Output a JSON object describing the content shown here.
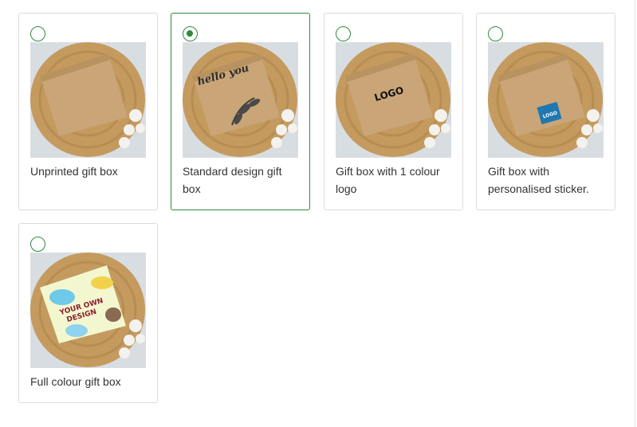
{
  "options": [
    {
      "label": "Unprinted gift box",
      "selected": false,
      "box_print": "",
      "image": "plain-kraft-box"
    },
    {
      "label": "Standard design gift box",
      "selected": true,
      "box_print": "hello you",
      "image": "hello-you-design-box"
    },
    {
      "label": "Gift box with 1 colour logo",
      "selected": false,
      "box_print": "LOGO",
      "image": "logo-print-box"
    },
    {
      "label": "Gift box with personalised sticker.",
      "selected": false,
      "box_print": "LOGO",
      "image": "logo-sticker-box"
    },
    {
      "label": "Full colour gift box",
      "selected": false,
      "box_print": "YOUR OWN DESIGN",
      "image": "full-colour-box"
    }
  ],
  "colors": {
    "accent": "#2e8b3d",
    "card_border": "#dcdcdc",
    "text": "#333333",
    "kraft": "#c9a577",
    "wicker": "#c49a5e",
    "sticker": "#1f78b0"
  }
}
